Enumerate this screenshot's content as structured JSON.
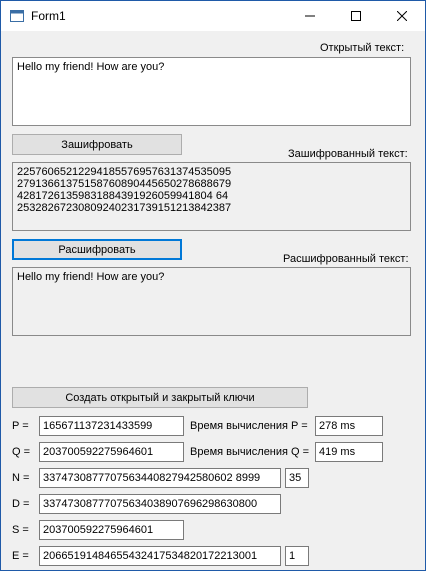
{
  "window": {
    "title": "Form1"
  },
  "labels": {
    "open_text": "Открытый текст:",
    "encrypted_text": "Зашифрованный текст:",
    "decrypted_text": "Расшифрованный текст:",
    "p": "P  =",
    "q": "Q  =",
    "n": "N  =",
    "d": "D  =",
    "s": "S  =",
    "e": "E  =",
    "time_p": "Время вычисления P =",
    "time_q": "Время вычисления Q ="
  },
  "open_text": "Hello my friend! How are you?",
  "encrypted_text": "22576065212294185576957631374535095\n27913661375158760890445650278688679\n42817261359831884391926059941804 64\n25328267230809240231739151213842387",
  "decrypted_text": "Hello my friend! How are you?",
  "buttons": {
    "encrypt": "Зашифровать",
    "decrypt": "Расшифровать",
    "create_keys": "Создать открытый и закрытый ключи"
  },
  "fields": {
    "p": "165671137231433599",
    "q": "203700592275964601",
    "n": "3374730877707563440827942580602 8999",
    "n_bits": "35",
    "d": "33747308777075634038907696298630800",
    "s": "203700592275964601",
    "e": "20665191484655432417534820172213001",
    "e_extra": "1",
    "time_p": "278 ms",
    "time_q": "419 ms"
  }
}
